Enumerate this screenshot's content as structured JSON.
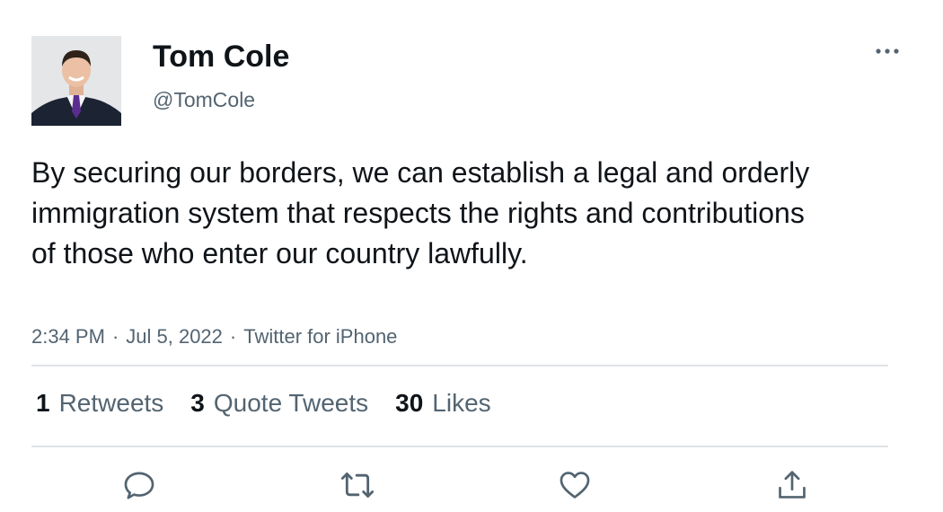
{
  "author": {
    "name": "Tom Cole",
    "handle": "@TomCole"
  },
  "tweet": {
    "text": "By securing our borders, we can establish a legal and orderly immigration system that respects the rights and contributions of those who enter our country lawfully.",
    "time": "2:34 PM",
    "date": "Jul 5, 2022",
    "source": "Twitter for iPhone",
    "separator": "·"
  },
  "stats": {
    "retweets": {
      "count": "1",
      "label": "Retweets"
    },
    "quotes": {
      "count": "3",
      "label": "Quote Tweets"
    },
    "likes": {
      "count": "30",
      "label": "Likes"
    }
  },
  "icons": {
    "more": "more-options-icon",
    "reply": "reply-icon",
    "retweet": "retweet-icon",
    "like": "heart-icon",
    "share": "share-icon"
  },
  "colors": {
    "text": "#0f1419",
    "secondary": "#536471",
    "divider": "#dfe3e6",
    "tie": "#5b2c8f"
  }
}
